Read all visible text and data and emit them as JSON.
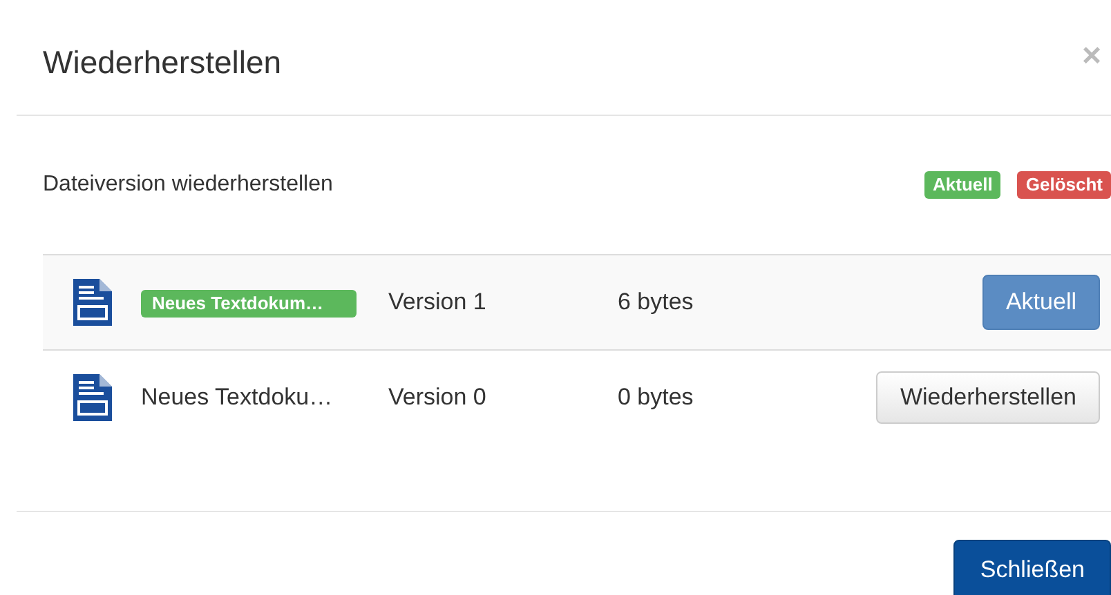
{
  "dialog": {
    "title": "Wiederherstellen",
    "close": "×"
  },
  "section": {
    "title": "Dateiversion wiederherstellen",
    "legend": [
      {
        "kind": "current",
        "label": "Aktuell"
      },
      {
        "kind": "deleted",
        "label": "Gelöscht"
      }
    ]
  },
  "versions": [
    {
      "name": "Neues Textdokum…",
      "current": true,
      "version": "Version 1",
      "size": "6 bytes",
      "action": "Aktuell"
    },
    {
      "name": "Neues Textdoku…",
      "current": false,
      "version": "Version 0",
      "size": "0 bytes",
      "action": "Wiederherstellen"
    }
  ],
  "footer": {
    "button": "Schließen"
  }
}
